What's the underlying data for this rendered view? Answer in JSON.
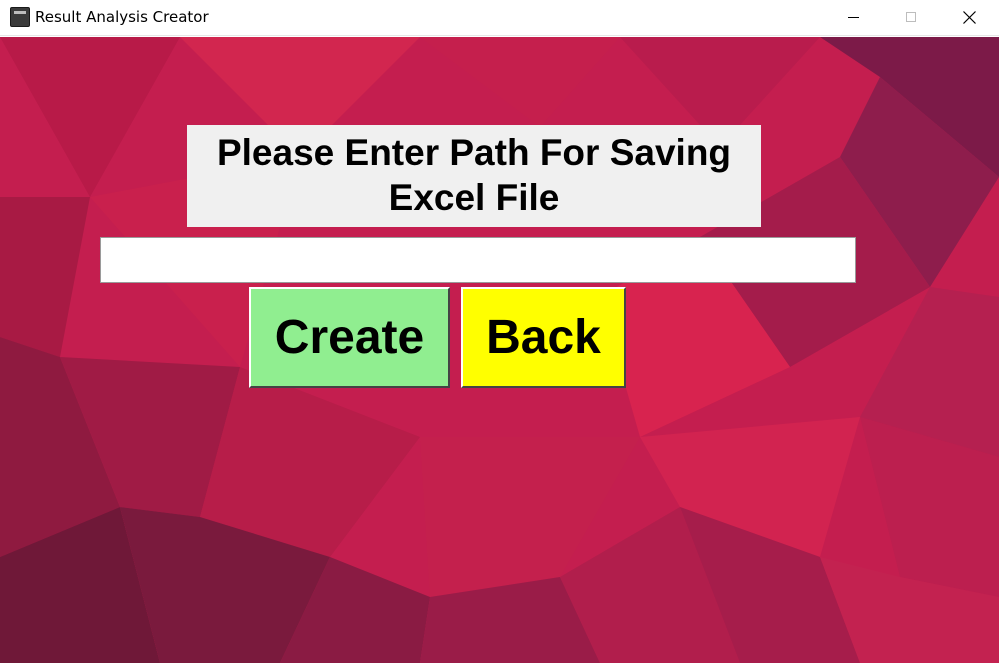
{
  "window": {
    "title": "Result Analysis Creator",
    "controls": [
      "minimize-icon",
      "maximize-icon",
      "close-icon"
    ]
  },
  "form": {
    "prompt_label": "Please Enter Path For Saving\nExcel File",
    "path_input": {
      "value": "",
      "placeholder": ""
    },
    "create_label": "Create",
    "back_label": "Back"
  },
  "colors": {
    "background": "#c41e4f",
    "create_button": "#90ee90",
    "back_button": "#ffff00",
    "label_bg": "#f0f0f0"
  }
}
